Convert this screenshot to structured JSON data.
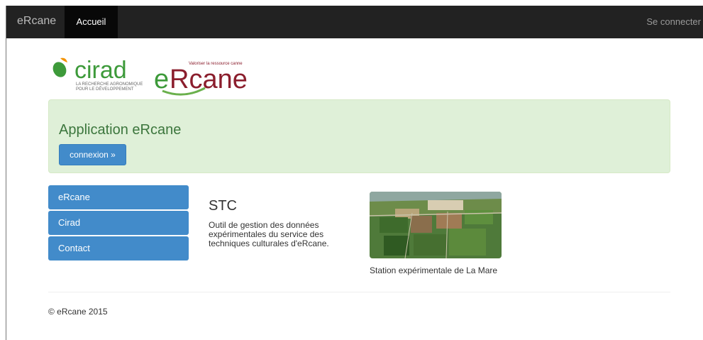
{
  "navbar": {
    "brand": "eRcane",
    "active_item": "Accueil",
    "login_link": "Se connecter"
  },
  "logos": {
    "cirad_name": "cirad",
    "cirad_tagline_1": "LA RECHERCHE AGRONOMIQUE",
    "cirad_tagline_2": "POUR LE DÉVELOPPEMENT",
    "ercane_slogan": "Valoriser la ressource canne",
    "ercane_name_e": "e",
    "ercane_name_rest": "Rcane"
  },
  "jumbotron": {
    "title": "Application eRcane",
    "button_label": "connexion »"
  },
  "sidebar": {
    "items": [
      {
        "label": "eRcane"
      },
      {
        "label": "Cirad"
      },
      {
        "label": "Contact"
      }
    ]
  },
  "main": {
    "title": "STC",
    "description": "Outil de gestion des données expérimentales du service des techniques culturales d'eRcane.",
    "photo_caption": "Station expérimentale de La Mare"
  },
  "footer": {
    "copyright": "© eRcane 2015"
  },
  "colors": {
    "navbar": "#222222",
    "primary": "#428bca",
    "success_bg": "#dff0d8",
    "success_text": "#3c763d",
    "cirad_green": "#3d9a3a",
    "ercane_red": "#8b1e2d"
  }
}
